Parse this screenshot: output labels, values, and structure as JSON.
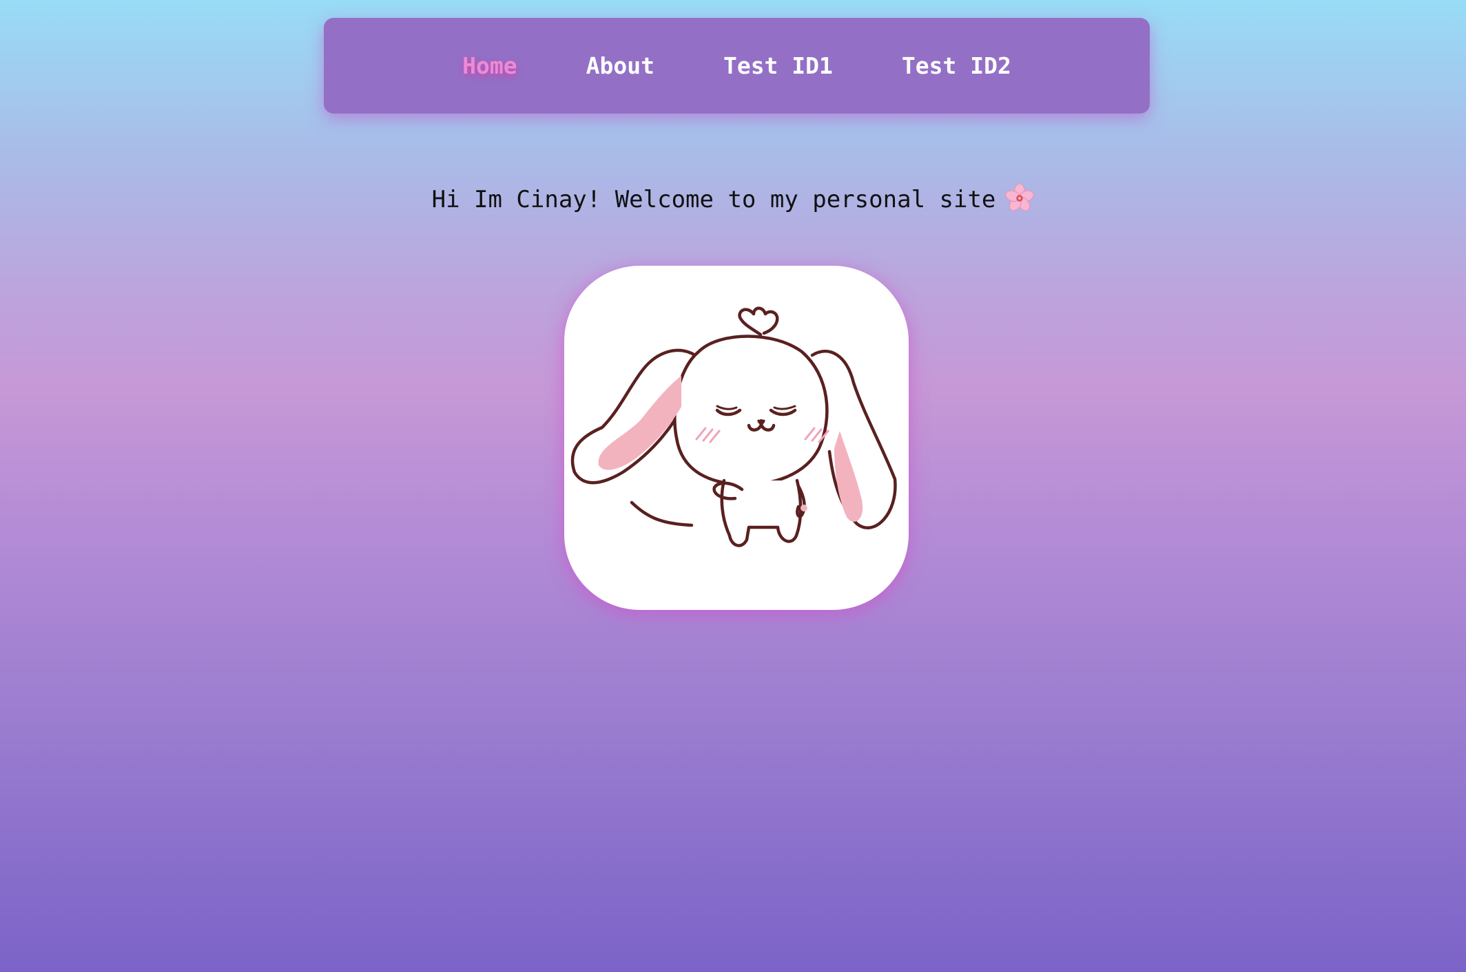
{
  "nav": {
    "items": [
      {
        "label": "Home",
        "active": true
      },
      {
        "label": "About",
        "active": false
      },
      {
        "label": "Test ID1",
        "active": false
      },
      {
        "label": "Test ID2",
        "active": false
      }
    ]
  },
  "main": {
    "welcome_text": "Hi Im Cinay! Welcome to my personal site",
    "welcome_icon": "cherry-blossom-icon",
    "avatar_icon": "bunny-avatar-icon"
  },
  "colors": {
    "nav_background": "#9370c6",
    "nav_active": "#ee8ad4",
    "nav_text": "#ffffff",
    "background_top": "#98dcf6",
    "background_bottom": "#7b63c8"
  }
}
